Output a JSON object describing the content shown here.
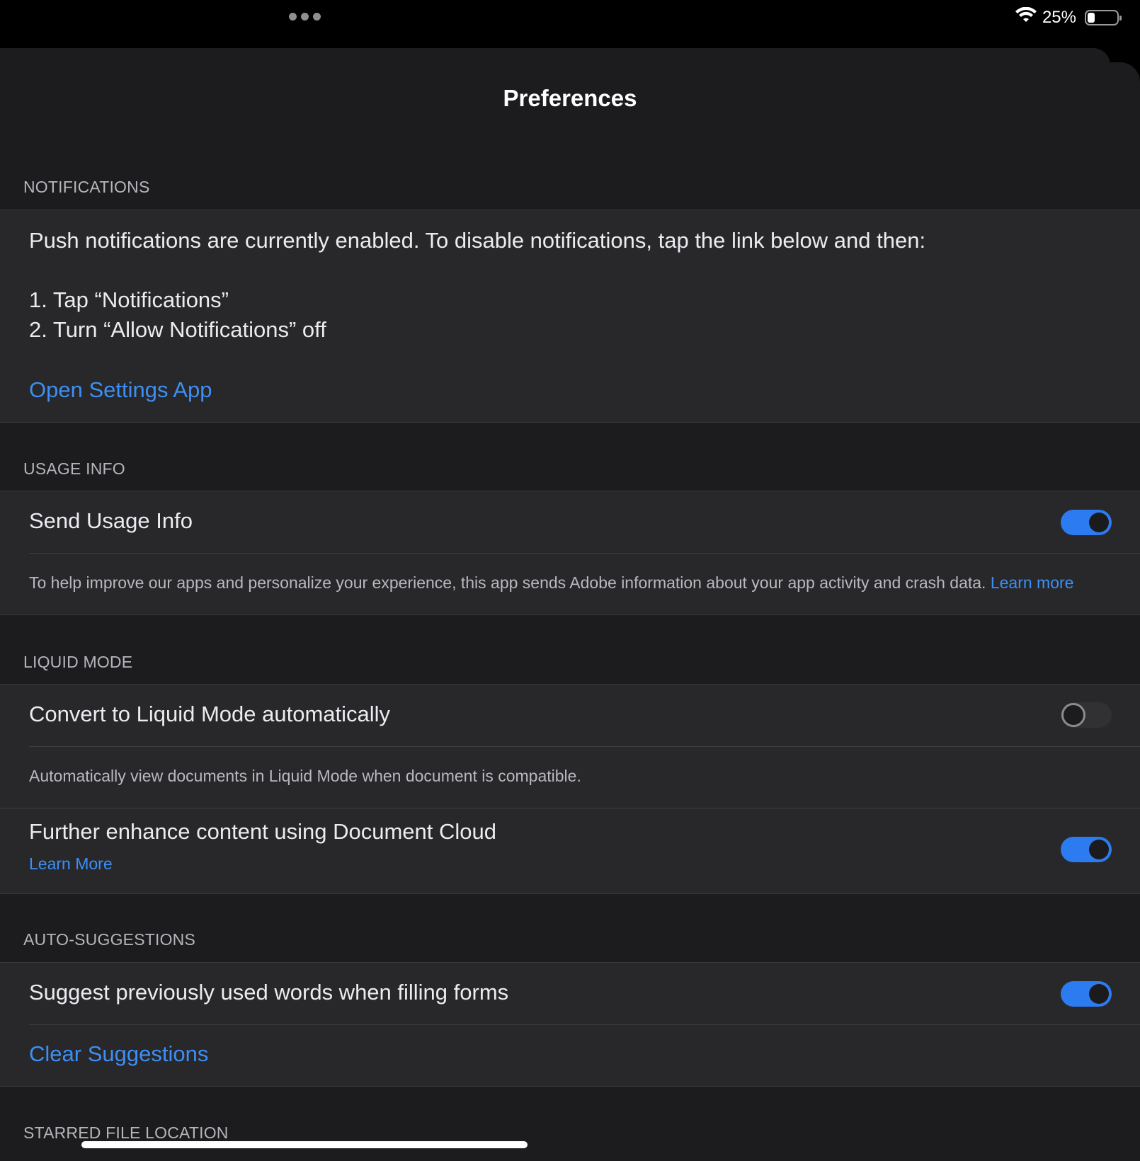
{
  "status_bar": {
    "battery_percent": "25%",
    "battery_level": 0.25,
    "wifi_icon": "wifi-icon",
    "multitasking_icon": "ellipsis-dots-icon"
  },
  "page": {
    "title": "Preferences"
  },
  "notifications": {
    "header": "NOTIFICATIONS",
    "body": "Push notifications are currently enabled. To disable notifications, tap the link below and then:",
    "step1": "1. Tap “Notifications”",
    "step2": "2. Turn “Allow Notifications” off",
    "link": "Open Settings App"
  },
  "usage_info": {
    "header": "USAGE INFO",
    "toggle_label": "Send Usage Info",
    "toggle_on": true,
    "description": "To help improve our apps and personalize your experience, this app sends Adobe information about your app activity and crash data.",
    "learn_more": "Learn more"
  },
  "liquid_mode": {
    "header": "LIQUID MODE",
    "convert_label": "Convert to Liquid Mode automatically",
    "convert_on": false,
    "convert_description": "Automatically view documents in Liquid Mode when document is compatible.",
    "enhance_label": "Further enhance content using Document Cloud",
    "enhance_learn_more": "Learn More",
    "enhance_on": true
  },
  "auto_suggestions": {
    "header": "AUTO-SUGGESTIONS",
    "suggest_label": "Suggest previously used words when filling forms",
    "suggest_on": true,
    "clear_link": "Clear Suggestions"
  },
  "starred": {
    "header": "STARRED FILE LOCATION"
  },
  "colors": {
    "accent": "#3d8ff5",
    "toggle_on": "#2d7bf0",
    "background": "#1c1c1e",
    "group_background": "#28282b"
  }
}
